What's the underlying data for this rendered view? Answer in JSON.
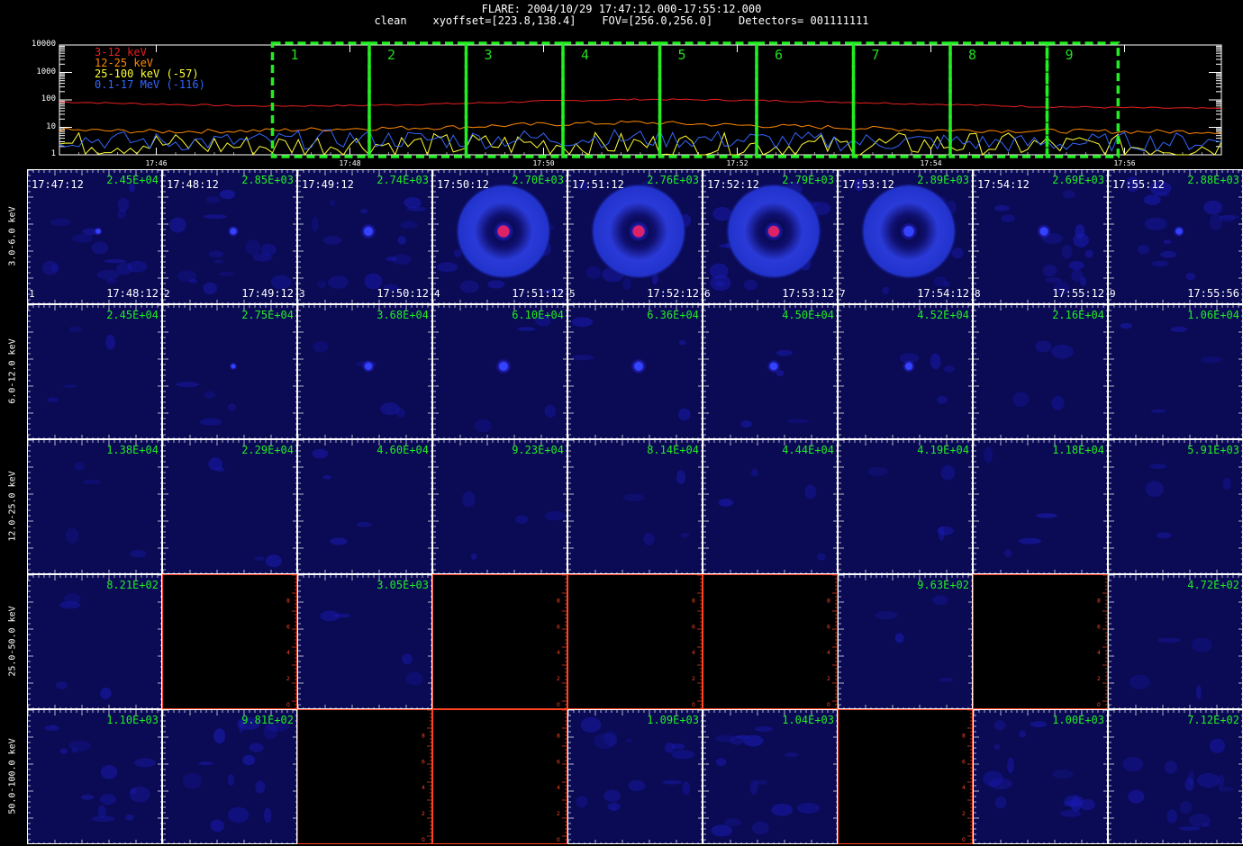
{
  "header": {
    "line1": "FLARE: 2004/10/29 17:47:12.000-17:55:12.000",
    "line2": "clean    xyoffset=[223.8,138.4]    FOV=[256.0,256.0]    Detectors= 001111111"
  },
  "chart_data": [
    {
      "type": "line",
      "yscale": "log",
      "ylim": [
        1,
        10000
      ],
      "ytick_labels": [
        "10000",
        "1000",
        "100",
        "10",
        "1"
      ],
      "xtick_labels": [
        "17:46",
        "17:48",
        "17:50",
        "17:52",
        "17:54",
        "17:56"
      ],
      "legend_placement": "top-left",
      "series": [
        {
          "name": "3-12 keV",
          "color": "#e82020",
          "x": [
            "17:45:00",
            "17:46:00",
            "17:47:00",
            "17:48:00",
            "17:49:00",
            "17:50:00",
            "17:51:00",
            "17:52:00",
            "17:53:00",
            "17:54:00",
            "17:55:00",
            "17:56:00",
            "17:57:00"
          ],
          "values": [
            85,
            70,
            60,
            62,
            72,
            90,
            105,
            98,
            85,
            70,
            58,
            52,
            48
          ]
        },
        {
          "name": "12-25 keV",
          "color": "#ff8800",
          "x": [
            "17:45:00",
            "17:46:00",
            "17:47:00",
            "17:48:00",
            "17:49:00",
            "17:50:00",
            "17:51:00",
            "17:52:00",
            "17:53:00",
            "17:54:00",
            "17:55:00",
            "17:56:00",
            "17:57:00"
          ],
          "values": [
            8,
            7,
            7.5,
            9,
            10,
            13,
            15,
            12,
            10,
            8,
            7.5,
            7,
            7
          ]
        },
        {
          "name": "25-100 keV (-57)",
          "color": "#ffff33",
          "x": [
            "17:45:00",
            "17:46:00",
            "17:47:00",
            "17:48:00",
            "17:49:00",
            "17:50:00",
            "17:51:00",
            "17:52:00",
            "17:53:00",
            "17:54:00",
            "17:55:00",
            "17:56:00",
            "17:57:00"
          ],
          "values": [
            2.5,
            2.5,
            2,
            2.5,
            2.2,
            2.5,
            2.3,
            2.2,
            2,
            2.5,
            2.2,
            2,
            2
          ]
        },
        {
          "name": "0.1-17 MeV (-116)",
          "color": "#3366ff",
          "x": [
            "17:45:00",
            "17:46:00",
            "17:47:00",
            "17:48:00",
            "17:49:00",
            "17:50:00",
            "17:51:00",
            "17:52:00",
            "17:53:00",
            "17:54:00",
            "17:55:00",
            "17:56:00",
            "17:57:00"
          ],
          "values": [
            4,
            3,
            3,
            4,
            3.5,
            4,
            4,
            3.5,
            3,
            3,
            2.5,
            3,
            3
          ]
        }
      ],
      "annotations": [
        "1",
        "2",
        "3",
        "4",
        "5",
        "6",
        "7",
        "8",
        "9"
      ],
      "intervals_color": "#22ee22"
    },
    {
      "type": "heatmap",
      "row_labels": [
        "3.0-6.0 keV",
        "6.0-12.0 keV",
        "12.0-25.0 keV",
        "25.0-50.0 keV",
        "50.0-100.0 keV"
      ],
      "start_times": [
        "17:47:12",
        "17:48:12",
        "17:49:12",
        "17:50:12",
        "17:51:12",
        "17:52:12",
        "17:53:12",
        "17:54:12",
        "17:55:12"
      ],
      "end_times": [
        "17:48:12",
        "17:49:12",
        "17:50:12",
        "17:51:12",
        "17:52:12",
        "17:53:12",
        "17:54:12",
        "17:55:12",
        "17:55:56"
      ],
      "interval_numbers": [
        "1",
        "2",
        "3",
        "4",
        "5",
        "6",
        "7",
        "8",
        "9"
      ],
      "peaks": [
        [
          "2.45E+04",
          "2.85E+03",
          "2.74E+03",
          "2.70E+03",
          "2.76E+03",
          "2.79E+03",
          "2.89E+03",
          "2.69E+03",
          "2.88E+03"
        ],
        [
          "2.45E+04",
          "2.75E+04",
          "3.68E+04",
          "6.10E+04",
          "6.36E+04",
          "4.50E+04",
          "4.52E+04",
          "2.16E+04",
          "1.06E+04"
        ],
        [
          "1.38E+04",
          "2.29E+04",
          "4.60E+04",
          "9.23E+04",
          "8.14E+04",
          "4.44E+04",
          "4.19E+04",
          "1.18E+04",
          "5.91E+03"
        ],
        [
          "8.21E+02",
          "",
          "3.05E+03",
          "",
          "",
          "",
          "9.63E+02",
          "",
          "4.72E+02"
        ],
        [
          "1.10E+03",
          "9.81E+02",
          "",
          "",
          "1.09E+03",
          "1.04E+03",
          "",
          "1.00E+03",
          "7.12E+02"
        ]
      ],
      "source_intensity": [
        [
          0.1,
          0.3,
          0.6,
          1.0,
          1.0,
          0.9,
          0.8,
          0.5,
          0.3
        ],
        [
          0.0,
          0.05,
          0.4,
          0.6,
          0.6,
          0.45,
          0.4,
          0.0,
          0.0
        ],
        [
          0.0,
          0,
          0,
          0,
          0,
          0,
          0,
          0,
          0
        ],
        [
          0,
          0,
          0,
          0,
          0,
          0,
          0,
          0,
          0
        ],
        [
          0,
          0,
          0,
          0,
          0,
          0,
          0,
          0,
          0
        ]
      ],
      "ring": [
        false,
        false,
        false,
        true,
        true,
        true,
        true,
        false,
        false
      ],
      "empty_axis_ticks": [
        "0",
        "2",
        "4",
        "6",
        "8"
      ]
    }
  ]
}
